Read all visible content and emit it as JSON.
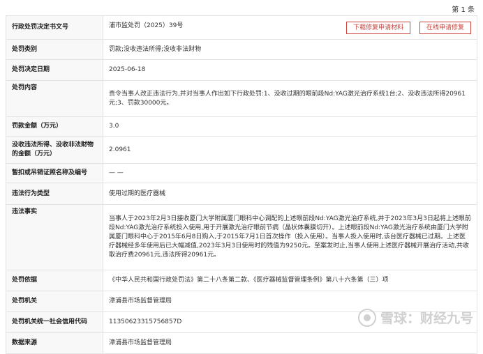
{
  "page_number": "第 1 条",
  "actions": {
    "download_label": "下载修复申请材料",
    "online_label": "在线申请修复"
  },
  "rows": {
    "doc_no": {
      "label": "行政处罚决定书文号",
      "value": "浦市监处罚（2025）39号"
    },
    "category": {
      "label": "处罚类别",
      "value": "罚款;没收违法所得;没收非法财物"
    },
    "date": {
      "label": "处罚决定日期",
      "value": "2025-06-18"
    },
    "content": {
      "label": "处罚内容",
      "value": "责令当事人改正违法行为,并对当事人作出如下行政处罚:1、没收过期的眼前段Nd:YAG激光治疗系统1台;2、没收违法所得20961元;3、罚款30000元。"
    },
    "fine": {
      "label": "罚款金额（万元）",
      "value": "3.0"
    },
    "confiscation": {
      "label": "没收违法所得、没收非法财物的金额（万元）",
      "value": "2.0961"
    },
    "license": {
      "label": "暂扣或吊销证照名称及编号",
      "value": "— —"
    },
    "violation_type": {
      "label": "违法行为类型",
      "value": "使用过期的医疗器械"
    },
    "facts": {
      "label": "违法事实",
      "value": "当事人于2023年2月3日接收厦门大学附属厦门眼科中心调配的上述眼前段Nd:YAG激光治疗系统,并于2023年3月3日起将上述眼前段Nd:YAG激光治疗系统投入使用,用于开展激光治疗眼前节病（晶状体囊膜切开）。上述眼前段Nd:YAG激光治疗系统由厦门大学附属厦门眼科中心于2015年6月8日购入,于2015年7月1日首次操作（投入使用）。当事人投入使用时,该台医疗器械已过期。上述医疗器械经多年使用后已大幅减值,2023年3月3日使用时的残值为9250元。至案发时止,当事人使用上述医疗器械开展治疗活动,共收取治疗费20961元,违法所得20961元。"
    },
    "basis": {
      "label": "处罚依据",
      "value": "《中华人民共和国行政处罚法》第二十八条第二款、《医疗器械监督管理条例》第八十六条第（三）项"
    },
    "authority": {
      "label": "处罚机关",
      "value": "漳浦县市场监督管理局"
    },
    "credit_code": {
      "label": "处罚机关统一社会信用代码",
      "value": "11350623315756857D"
    },
    "source": {
      "label": "数据来源",
      "value": "漳浦县市场监督管理局"
    }
  },
  "watermark_text": "雪球：财经九号",
  "icons": {
    "watermark_logo": "snowball-logo-icon"
  },
  "colors": {
    "accent": "#c9413a",
    "label_bg": "#f8f8f8",
    "border": "#e3e3e3"
  }
}
